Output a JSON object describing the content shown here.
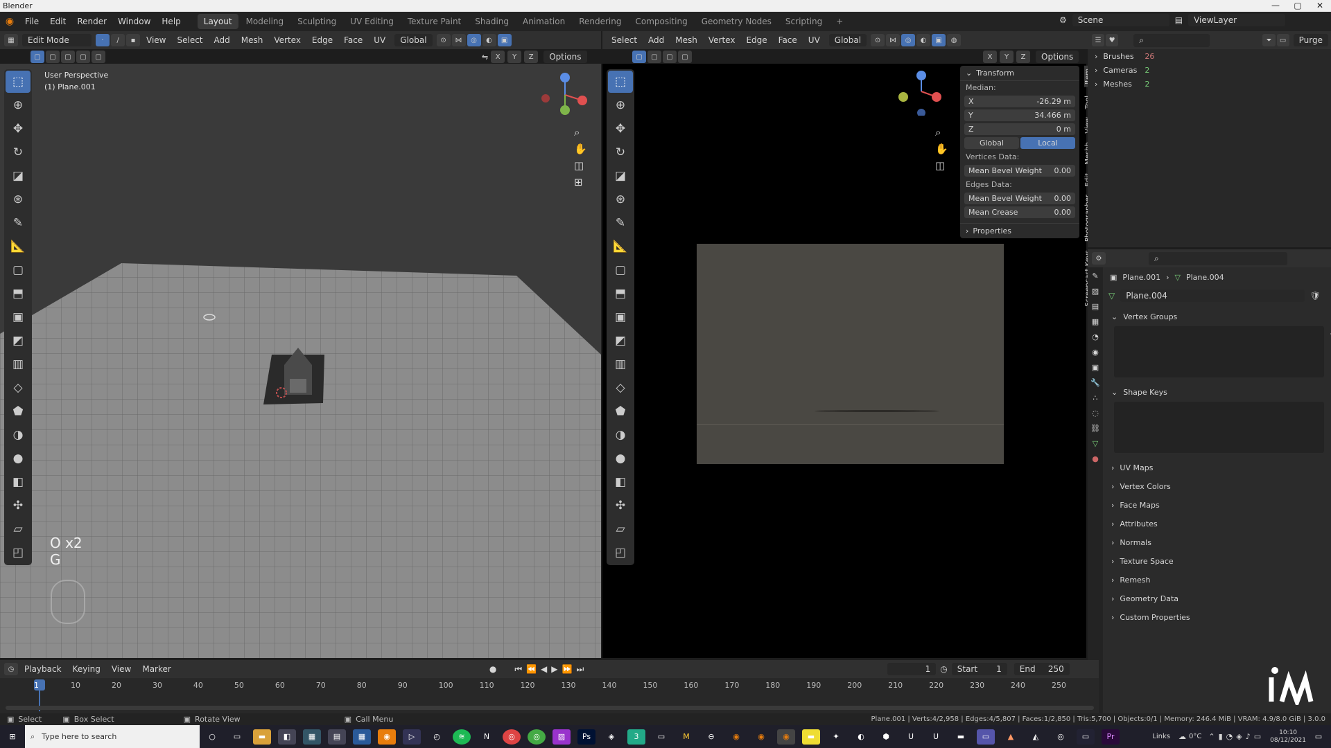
{
  "window": {
    "title": "Blender"
  },
  "topbar": {
    "menus": [
      "File",
      "Edit",
      "Render",
      "Window",
      "Help"
    ],
    "workspaces": [
      "Layout",
      "Modeling",
      "Sculpting",
      "UV Editing",
      "Texture Paint",
      "Shading",
      "Animation",
      "Rendering",
      "Compositing",
      "Geometry Nodes",
      "Scripting",
      "+"
    ],
    "active_workspace": "Layout",
    "scene": "Scene",
    "view_layer": "ViewLayer"
  },
  "left_viewport": {
    "mode": "Edit Mode",
    "menus": [
      "View",
      "Select",
      "Add",
      "Mesh",
      "Vertex",
      "Edge",
      "Face",
      "UV"
    ],
    "orientation": "Global",
    "options_label": "Options",
    "axes": [
      "X",
      "Y",
      "Z"
    ],
    "view_name": "User Perspective",
    "object_name": "(1) Plane.001",
    "key_overlay": [
      "O x2",
      "G"
    ]
  },
  "right_viewport": {
    "menus": [
      "Select",
      "Add",
      "Mesh",
      "Vertex",
      "Edge",
      "Face",
      "UV"
    ],
    "orientation": "Global",
    "options_label": "Options",
    "axes": [
      "X",
      "Y",
      "Z"
    ]
  },
  "n_panel": {
    "header": "Transform",
    "median_label": "Median:",
    "fields": [
      {
        "label": "X",
        "value": "-26.29 m"
      },
      {
        "label": "Y",
        "value": "34.466 m"
      },
      {
        "label": "Z",
        "value": "0 m"
      }
    ],
    "toggle": [
      "Global",
      "Local"
    ],
    "active_toggle": "Local",
    "vertices_label": "Vertices Data:",
    "vertices_fields": [
      {
        "label": "Mean Bevel Weight",
        "value": "0.00"
      }
    ],
    "edges_label": "Edges Data:",
    "edges_fields": [
      {
        "label": "Mean Bevel Weight",
        "value": "0.00"
      },
      {
        "label": "Mean Crease",
        "value": "0.00"
      }
    ],
    "properties_label": "Properties",
    "tabs": [
      "Item",
      "Tool",
      "View",
      "Meshh",
      "Edit",
      "Photographer",
      "Screencast Keys"
    ]
  },
  "outliner": {
    "items": [
      {
        "label": "Brushes",
        "count": "26"
      },
      {
        "label": "Cameras",
        "count": "2"
      },
      {
        "label": "Meshes",
        "count": "2"
      }
    ],
    "purge": "Purge"
  },
  "properties": {
    "breadcrumb": [
      "Plane.001",
      "Plane.004"
    ],
    "mesh_name": "Plane.004",
    "panels": [
      "Vertex Groups",
      "Shape Keys",
      "UV Maps",
      "Vertex Colors",
      "Face Maps",
      "Attributes",
      "Normals",
      "Texture Space",
      "Remesh",
      "Geometry Data",
      "Custom Properties"
    ]
  },
  "timeline": {
    "menus": [
      "Playback",
      "Keying",
      "View",
      "Marker"
    ],
    "current_frame": "1",
    "start_label": "Start",
    "start": "1",
    "end_label": "End",
    "end": "250",
    "ticks": [
      "1",
      "10",
      "20",
      "30",
      "40",
      "50",
      "60",
      "70",
      "80",
      "90",
      "100",
      "110",
      "120",
      "130",
      "140",
      "150",
      "160",
      "170",
      "180",
      "190",
      "200",
      "210",
      "220",
      "230",
      "240",
      "250"
    ]
  },
  "status_bar": {
    "hints": [
      "Select",
      "Box Select",
      "Rotate View",
      "Call Menu"
    ],
    "stats": "Plane.001 | Verts:4/2,958 | Edges:4/5,807 | Faces:1/2,850 | Tris:5,700 | Objects:0/1 | Memory: 246.4 MiB | VRAM: 4.9/8.0 GiB | 3.0.0"
  },
  "taskbar": {
    "search_placeholder": "Type here to search",
    "links": "Links",
    "temp": "0°C",
    "time": "10:10",
    "date": "08/12/2021"
  }
}
